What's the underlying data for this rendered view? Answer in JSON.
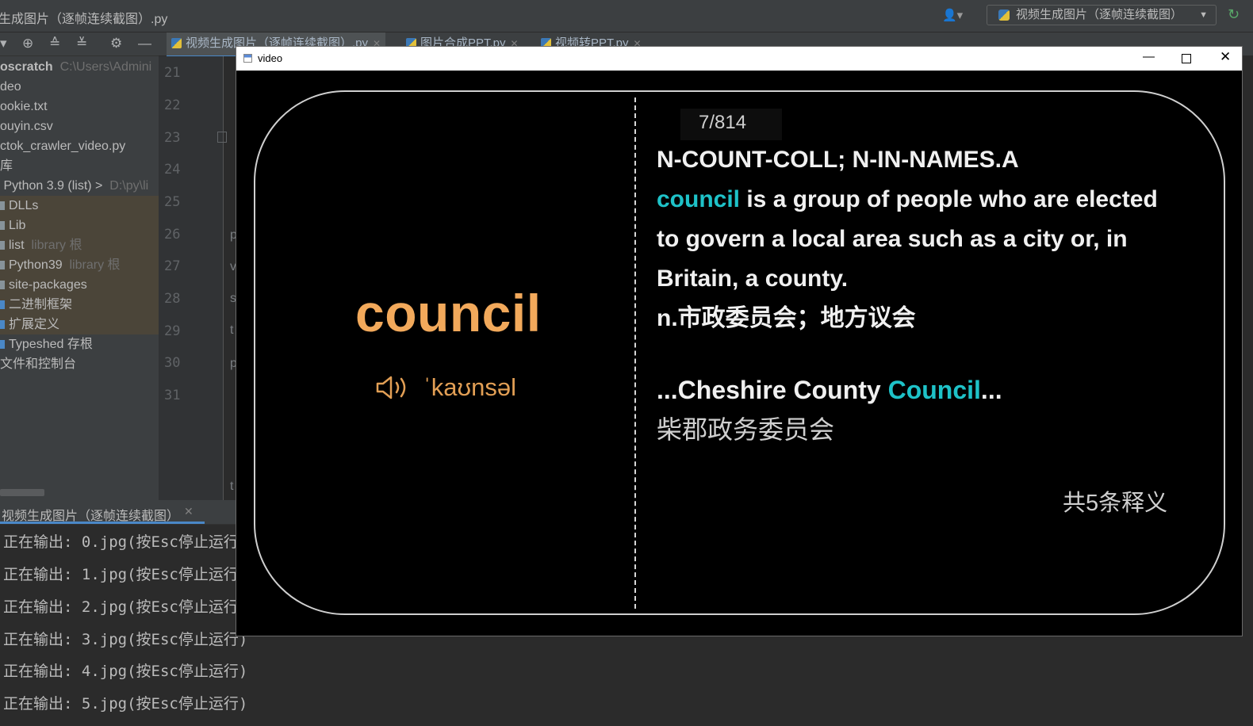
{
  "ide": {
    "title": "生成图片（逐帧连续截图）.py",
    "run_config": "视频生成图片（逐帧连续截图）",
    "user_icon": "user-icon"
  },
  "tabs": [
    {
      "label": "视频生成图片（逐帧连续截图）.py"
    },
    {
      "label": "图片合成PPT.py"
    },
    {
      "label": "视频转PPT.py"
    }
  ],
  "tree": {
    "items": [
      {
        "label": "oscratch",
        "path": "C:\\Users\\Admini"
      },
      {
        "label": "deo"
      },
      {
        "label": "ookie.txt"
      },
      {
        "label": "ouyin.csv"
      },
      {
        "label": "ctok_crawler_video.py"
      },
      {
        "label": "库"
      },
      {
        "label": "Python 3.9 (list) >",
        "path": "D:\\py\\li"
      },
      {
        "label": "DLLs"
      },
      {
        "label": "Lib"
      },
      {
        "label": "list",
        "tag": "library 根"
      },
      {
        "label": "Python39",
        "tag": "library 根"
      },
      {
        "label": "site-packages"
      },
      {
        "label": "二进制框架"
      },
      {
        "label": "扩展定义"
      },
      {
        "label": "Typeshed 存根"
      },
      {
        "label": "文件和控制台"
      }
    ]
  },
  "editor": {
    "line_numbers": [
      "21",
      "22",
      "23",
      "24",
      "25",
      "26",
      "27",
      "28",
      "29",
      "30",
      "31"
    ],
    "code_chars": [
      "p",
      "v",
      "s",
      "t",
      "p",
      "t"
    ]
  },
  "run_panel": {
    "tab_label": "视频生成图片（逐帧连续截图）",
    "lines": [
      "正在输出: 0.jpg(按Esc停止运行)",
      "正在输出: 1.jpg(按Esc停止运行)",
      "正在输出: 2.jpg(按Esc停止运行)",
      "正在输出: 3.jpg(按Esc停止运行)",
      "正在输出: 4.jpg(按Esc停止运行)",
      "正在输出: 5.jpg(按Esc停止运行)"
    ]
  },
  "video_window": {
    "title": "video",
    "minimize": "—",
    "close": "✕"
  },
  "card": {
    "word": "council",
    "phonetic": "ˈkaʊnsəl",
    "counter": "7/814",
    "definition_line1": "N-COUNT-COLL; N-IN-NAMES.A",
    "definition_highlight": "council",
    "definition_rest": " is a group of people who are elected to govern a local area such as a city or, in Britain, a county.",
    "definition_cn": "n.市政委员会；地方议会",
    "example_pre": "...Cheshire County ",
    "example_highlight": "Council",
    "example_post": "...",
    "example_cn": "柴郡政务委员会",
    "total": "共5条释义"
  },
  "colors": {
    "word": "#f2a95b",
    "highlight": "#1ec2c8",
    "ide_bg": "#2b2b2b",
    "panel_bg": "#3c3f41"
  }
}
